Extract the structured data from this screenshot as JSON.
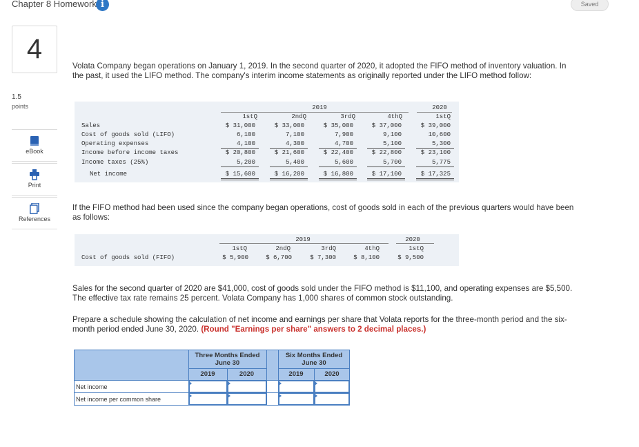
{
  "header": {
    "title": "Chapter 8 Homework",
    "saved_label": "Saved",
    "info_icon": "i"
  },
  "question": {
    "number": "4",
    "points_value": "1.5",
    "points_label": "points"
  },
  "rail": [
    {
      "label": "eBook",
      "icon": "book-icon"
    },
    {
      "label": "Print",
      "icon": "print-icon"
    },
    {
      "label": "References",
      "icon": "references-icon"
    }
  ],
  "intro": "Volata Company began operations on January 1, 2019. In the second quarter of 2020, it adopted the FIFO method of inventory valuation. In the past, it used the LIFO method. The company's interim income statements as originally reported under the LIFO method follow:",
  "income_table": {
    "year_2019": "2019",
    "year_2020": "2020",
    "quarters": [
      "1stQ",
      "2ndQ",
      "3rdQ",
      "4thQ",
      "1stQ"
    ],
    "rows": [
      {
        "label": "Sales",
        "values": [
          "$ 31,000",
          "$ 33,000",
          "$ 35,000",
          "$ 37,000",
          "$ 39,000"
        ]
      },
      {
        "label": "Cost of goods sold (LIFO)",
        "values": [
          "6,100",
          "7,100",
          "7,900",
          "9,100",
          "10,600"
        ]
      },
      {
        "label": "Operating expenses",
        "values": [
          "4,100",
          "4,300",
          "4,700",
          "5,100",
          "5,300"
        ]
      },
      {
        "label": "Income before income taxes",
        "values": [
          "$ 20,800",
          "$ 21,600",
          "$ 22,400",
          "$ 22,800",
          "$ 23,100"
        ]
      },
      {
        "label": "Income taxes (25%)",
        "values": [
          "5,200",
          "5,400",
          "5,600",
          "5,700",
          "5,775"
        ]
      },
      {
        "label": "Net income",
        "values": [
          "$ 15,600",
          "$ 16,200",
          "$ 16,800",
          "$ 17,100",
          "$ 17,325"
        ]
      }
    ]
  },
  "fifo_intro": "If the FIFO method had been used since the company began operations, cost of goods sold in each of the previous quarters would have been as follows:",
  "fifo_table": {
    "year_2019": "2019",
    "year_2020": "2020",
    "quarters": [
      "1stQ",
      "2ndQ",
      "3rdQ",
      "4thQ",
      "1stQ"
    ],
    "row_label": "Cost of goods sold (FIFO)",
    "values": [
      "$ 5,900",
      "$ 6,700",
      "$ 7,300",
      "$ 8,100",
      "$ 9,500"
    ]
  },
  "facts": "Sales for the second quarter of 2020 are $41,000, cost of goods sold under the FIFO method is $11,100, and operating expenses are $5,500. The effective tax rate remains 25 percent. Volata Company has 1,000 shares of common stock outstanding.",
  "instruction": "Prepare a schedule showing the calculation of net income and earnings per share that Volata reports for the three-month period and the six-month period ended June 30, 2020.",
  "instruction_bold": "(Round \"Earnings per share\" answers to 2 decimal places.)",
  "answer": {
    "three_months_line1": "Three Months Ended",
    "three_months_line2": "June 30",
    "six_months_line1": "Six Months Ended",
    "six_months_line2": "June 30",
    "col_2019": "2019",
    "col_2020": "2020",
    "row1": "Net income",
    "row2": "Net income per common share",
    "values": [
      "",
      "",
      "",
      "",
      "",
      "",
      "",
      ""
    ]
  }
}
